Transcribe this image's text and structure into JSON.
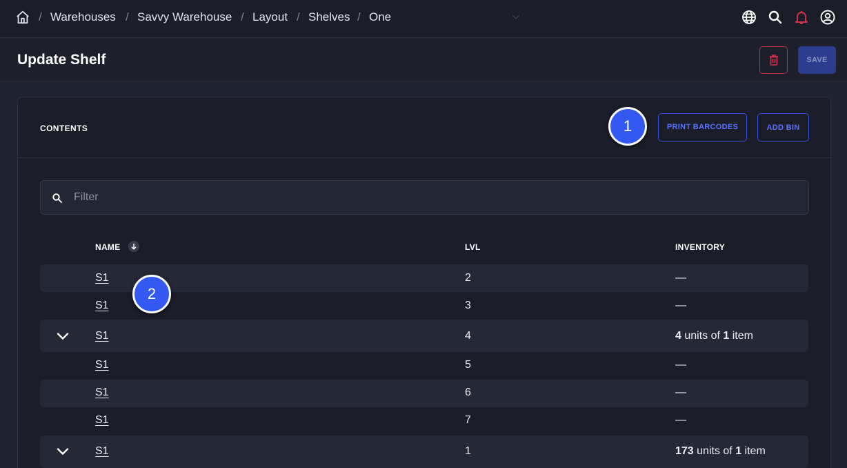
{
  "breadcrumb": {
    "items": [
      "Warehouses",
      "Savvy Warehouse",
      "Layout",
      "Shelves",
      "One"
    ],
    "separator": "/"
  },
  "topbar": {
    "icons": [
      "home-icon",
      "globe-icon",
      "search-icon",
      "bell-icon",
      "user-icon",
      "chevron-down-icon"
    ]
  },
  "header": {
    "title": "Update Shelf",
    "save_label": "SAVE"
  },
  "contents": {
    "title": "CONTENTS",
    "print_barcodes_label": "PRINT BARCODES",
    "add_bin_label": "ADD BIN",
    "filter_placeholder": "Filter"
  },
  "table": {
    "columns": {
      "name": "NAME",
      "lvl": "LVL",
      "inventory": "INVENTORY"
    },
    "rows": [
      {
        "name": "S1",
        "lvl": "2",
        "inventory": "—"
      },
      {
        "name": "S1",
        "lvl": "3",
        "inventory": "—"
      },
      {
        "name": "S1",
        "lvl": "4",
        "units": "4",
        "units_text": " units of ",
        "items": "1",
        "items_text": " item"
      },
      {
        "name": "S1",
        "lvl": "5",
        "inventory": "—"
      },
      {
        "name": "S1",
        "lvl": "6",
        "inventory": "—"
      },
      {
        "name": "S1",
        "lvl": "7",
        "inventory": "—"
      },
      {
        "name": "S1",
        "lvl": "1",
        "units": "173",
        "units_text": " units of ",
        "items": "1",
        "items_text": " item"
      }
    ]
  },
  "markers": {
    "one": "1",
    "two": "2"
  },
  "colors": {
    "accent": "#3458f2",
    "danger": "#b8324a",
    "background": "#202330",
    "card": "#1b1d29"
  }
}
